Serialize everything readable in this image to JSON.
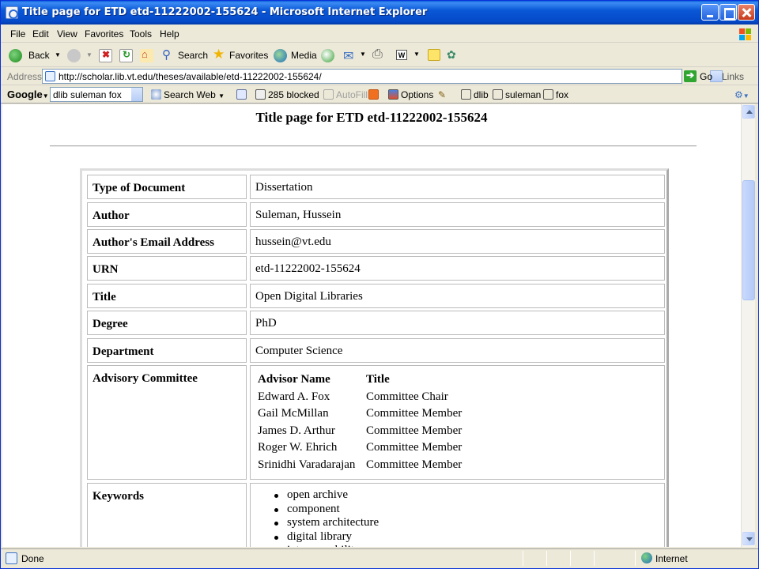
{
  "window": {
    "title": "Title page for ETD etd-11222002-155624 - Microsoft Internet Explorer"
  },
  "menu": {
    "items": [
      "File",
      "Edit",
      "View",
      "Favorites",
      "Tools",
      "Help"
    ]
  },
  "toolbar": {
    "back": "Back",
    "search": "Search",
    "favorites": "Favorites",
    "media": "Media"
  },
  "address": {
    "label": "Address",
    "url": "http://scholar.lib.vt.edu/theses/available/etd-11222002-155624/",
    "go": "Go",
    "links": "Links"
  },
  "google": {
    "logo": "Google",
    "query": "dlib suleman fox",
    "search_web": "Search Web",
    "blocked": "285 blocked",
    "autofill": "AutoFill",
    "options": "Options",
    "terms": [
      "dlib",
      "suleman",
      "fox"
    ]
  },
  "page": {
    "title": "Title page for ETD etd-11222002-155624",
    "rows": [
      {
        "label": "Type of Document",
        "value": "Dissertation"
      },
      {
        "label": "Author",
        "value": "Suleman, Hussein"
      },
      {
        "label": "Author's Email Address",
        "value": "hussein@vt.edu"
      },
      {
        "label": "URN",
        "value": "etd-11222002-155624"
      },
      {
        "label": "Title",
        "value": "Open Digital Libraries"
      },
      {
        "label": "Degree",
        "value": "PhD"
      },
      {
        "label": "Department",
        "value": "Computer Science"
      }
    ],
    "committee": {
      "label": "Advisory Committee",
      "headers": [
        "Advisor Name",
        "Title"
      ],
      "members": [
        {
          "name": "Edward A. Fox",
          "title": "Committee Chair"
        },
        {
          "name": "Gail McMillan",
          "title": "Committee Member"
        },
        {
          "name": "James D. Arthur",
          "title": "Committee Member"
        },
        {
          "name": "Roger W. Ehrich",
          "title": "Committee Member"
        },
        {
          "name": "Srinidhi Varadarajan",
          "title": "Committee Member"
        }
      ]
    },
    "keywords": {
      "label": "Keywords",
      "items": [
        "open archive",
        "component",
        "system architecture",
        "digital library",
        "interoperability"
      ]
    }
  },
  "status": {
    "text": "Done",
    "zone": "Internet"
  }
}
